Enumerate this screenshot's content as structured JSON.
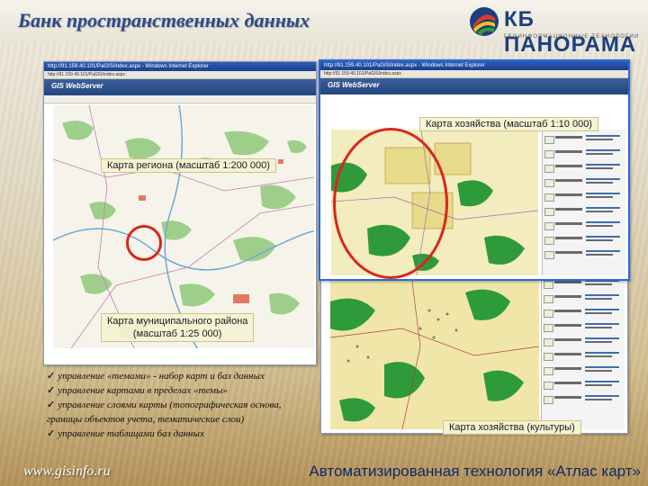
{
  "header": {
    "title": "Банк пространственных данных",
    "logo_name": "КБ ПАНОРАМА",
    "logo_tagline": "ГЕОИНФОРМАЦИОННЫЕ ТЕХНОЛОГИИ"
  },
  "windows": {
    "left": {
      "title_bar": "http://91.159.40.101/PaGIS/index.aspx - Windows Internet Explorer",
      "address": "http://91.159.40.101/PaGIS/index.aspx",
      "app_name": "GIS WebServer"
    },
    "right": {
      "title_bar": "http://91.159.40.101/PaGIS/index.aspx - Windows Internet Explorer",
      "address": "http://91.159.40.101/PaGIS/index.aspx",
      "app_name": "GIS WebServer"
    }
  },
  "map_labels": {
    "region": "Карта региона (масштаб 1:200 000)",
    "farm": "Карта хозяйства (масштаб 1:10 000)",
    "municipal_line1": "Карта муниципального района",
    "municipal_line2": "(масштаб 1:25 000)",
    "farm_crops": "Карта хозяйства (культуры)"
  },
  "features": [
    "управление «темами» - набор карт и баз данных",
    "управление картами в пределах «темы»",
    "управление слоями карты (топографическая основа, границы объектов учета, тематические слои)",
    "управление таблицами баз данных"
  ],
  "footer": {
    "url": "www.gisinfo.ru",
    "caption": "Автоматизированная технология «Атлас карт»"
  },
  "colors": {
    "title": "#2a4a8a",
    "highlight_circle": "#d8261c",
    "footer_caption": "#0f2a66"
  }
}
